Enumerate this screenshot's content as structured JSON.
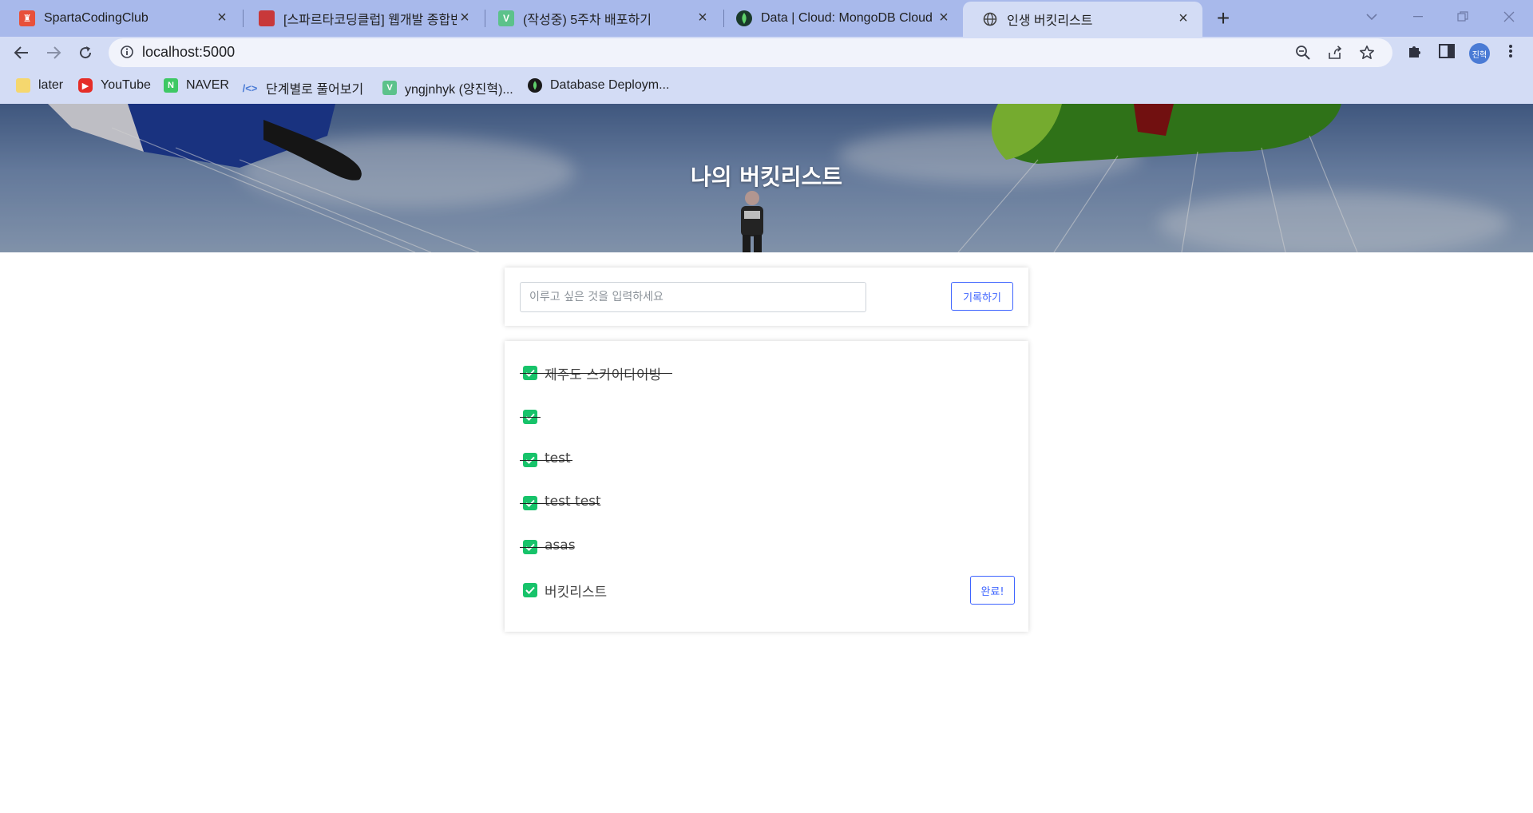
{
  "browser": {
    "tabs": [
      {
        "title": "SpartaCodingClub",
        "favicon_color": "#e8503a"
      },
      {
        "title": "[스파르타코딩클럽] 웹개발 종합반",
        "favicon_color": "#c8383a"
      },
      {
        "title": "(작성중) 5주차 배포하기",
        "favicon_color": "#5cc28b"
      },
      {
        "title": "Data | Cloud: MongoDB Cloud",
        "favicon_color": "#1a3a2a"
      },
      {
        "title": "인생 버킷리스트",
        "favicon_color": "#555555",
        "active": true
      }
    ],
    "url": "localhost:5000",
    "profile_label": "진혁",
    "bookmarks": [
      {
        "label": "later",
        "icon": "folder-icon",
        "color": "#f5d76e"
      },
      {
        "label": "YouTube",
        "icon": "youtube-icon",
        "color": "#e52d27"
      },
      {
        "label": "NAVER",
        "icon": "naver-icon",
        "color": "#3ec864"
      },
      {
        "label": "단계별로 풀어보기",
        "icon": "code-icon",
        "color": "#4a7bd5"
      },
      {
        "label": "yngjnhyk (양진혁)...",
        "icon": "velog-icon",
        "color": "#5cc28b"
      },
      {
        "label": "Database Deploym...",
        "icon": "mongodb-leaf-icon",
        "color": "#1a1a1a"
      }
    ]
  },
  "page": {
    "title": "나의 버킷리스트",
    "input_placeholder": "이루고 싶은 것을 입력하세요",
    "save_label": "기록하기",
    "done_label": "완료!",
    "accent": "#3e64ff",
    "check_color": "#17c36a",
    "items": [
      {
        "text": "제주도 스카이다이빙",
        "done": true
      },
      {
        "text": "",
        "done": true
      },
      {
        "text": "test",
        "done": true
      },
      {
        "text": "test test",
        "done": true
      },
      {
        "text": "asas",
        "done": true
      },
      {
        "text": "버킷리스트",
        "done": false
      }
    ]
  }
}
